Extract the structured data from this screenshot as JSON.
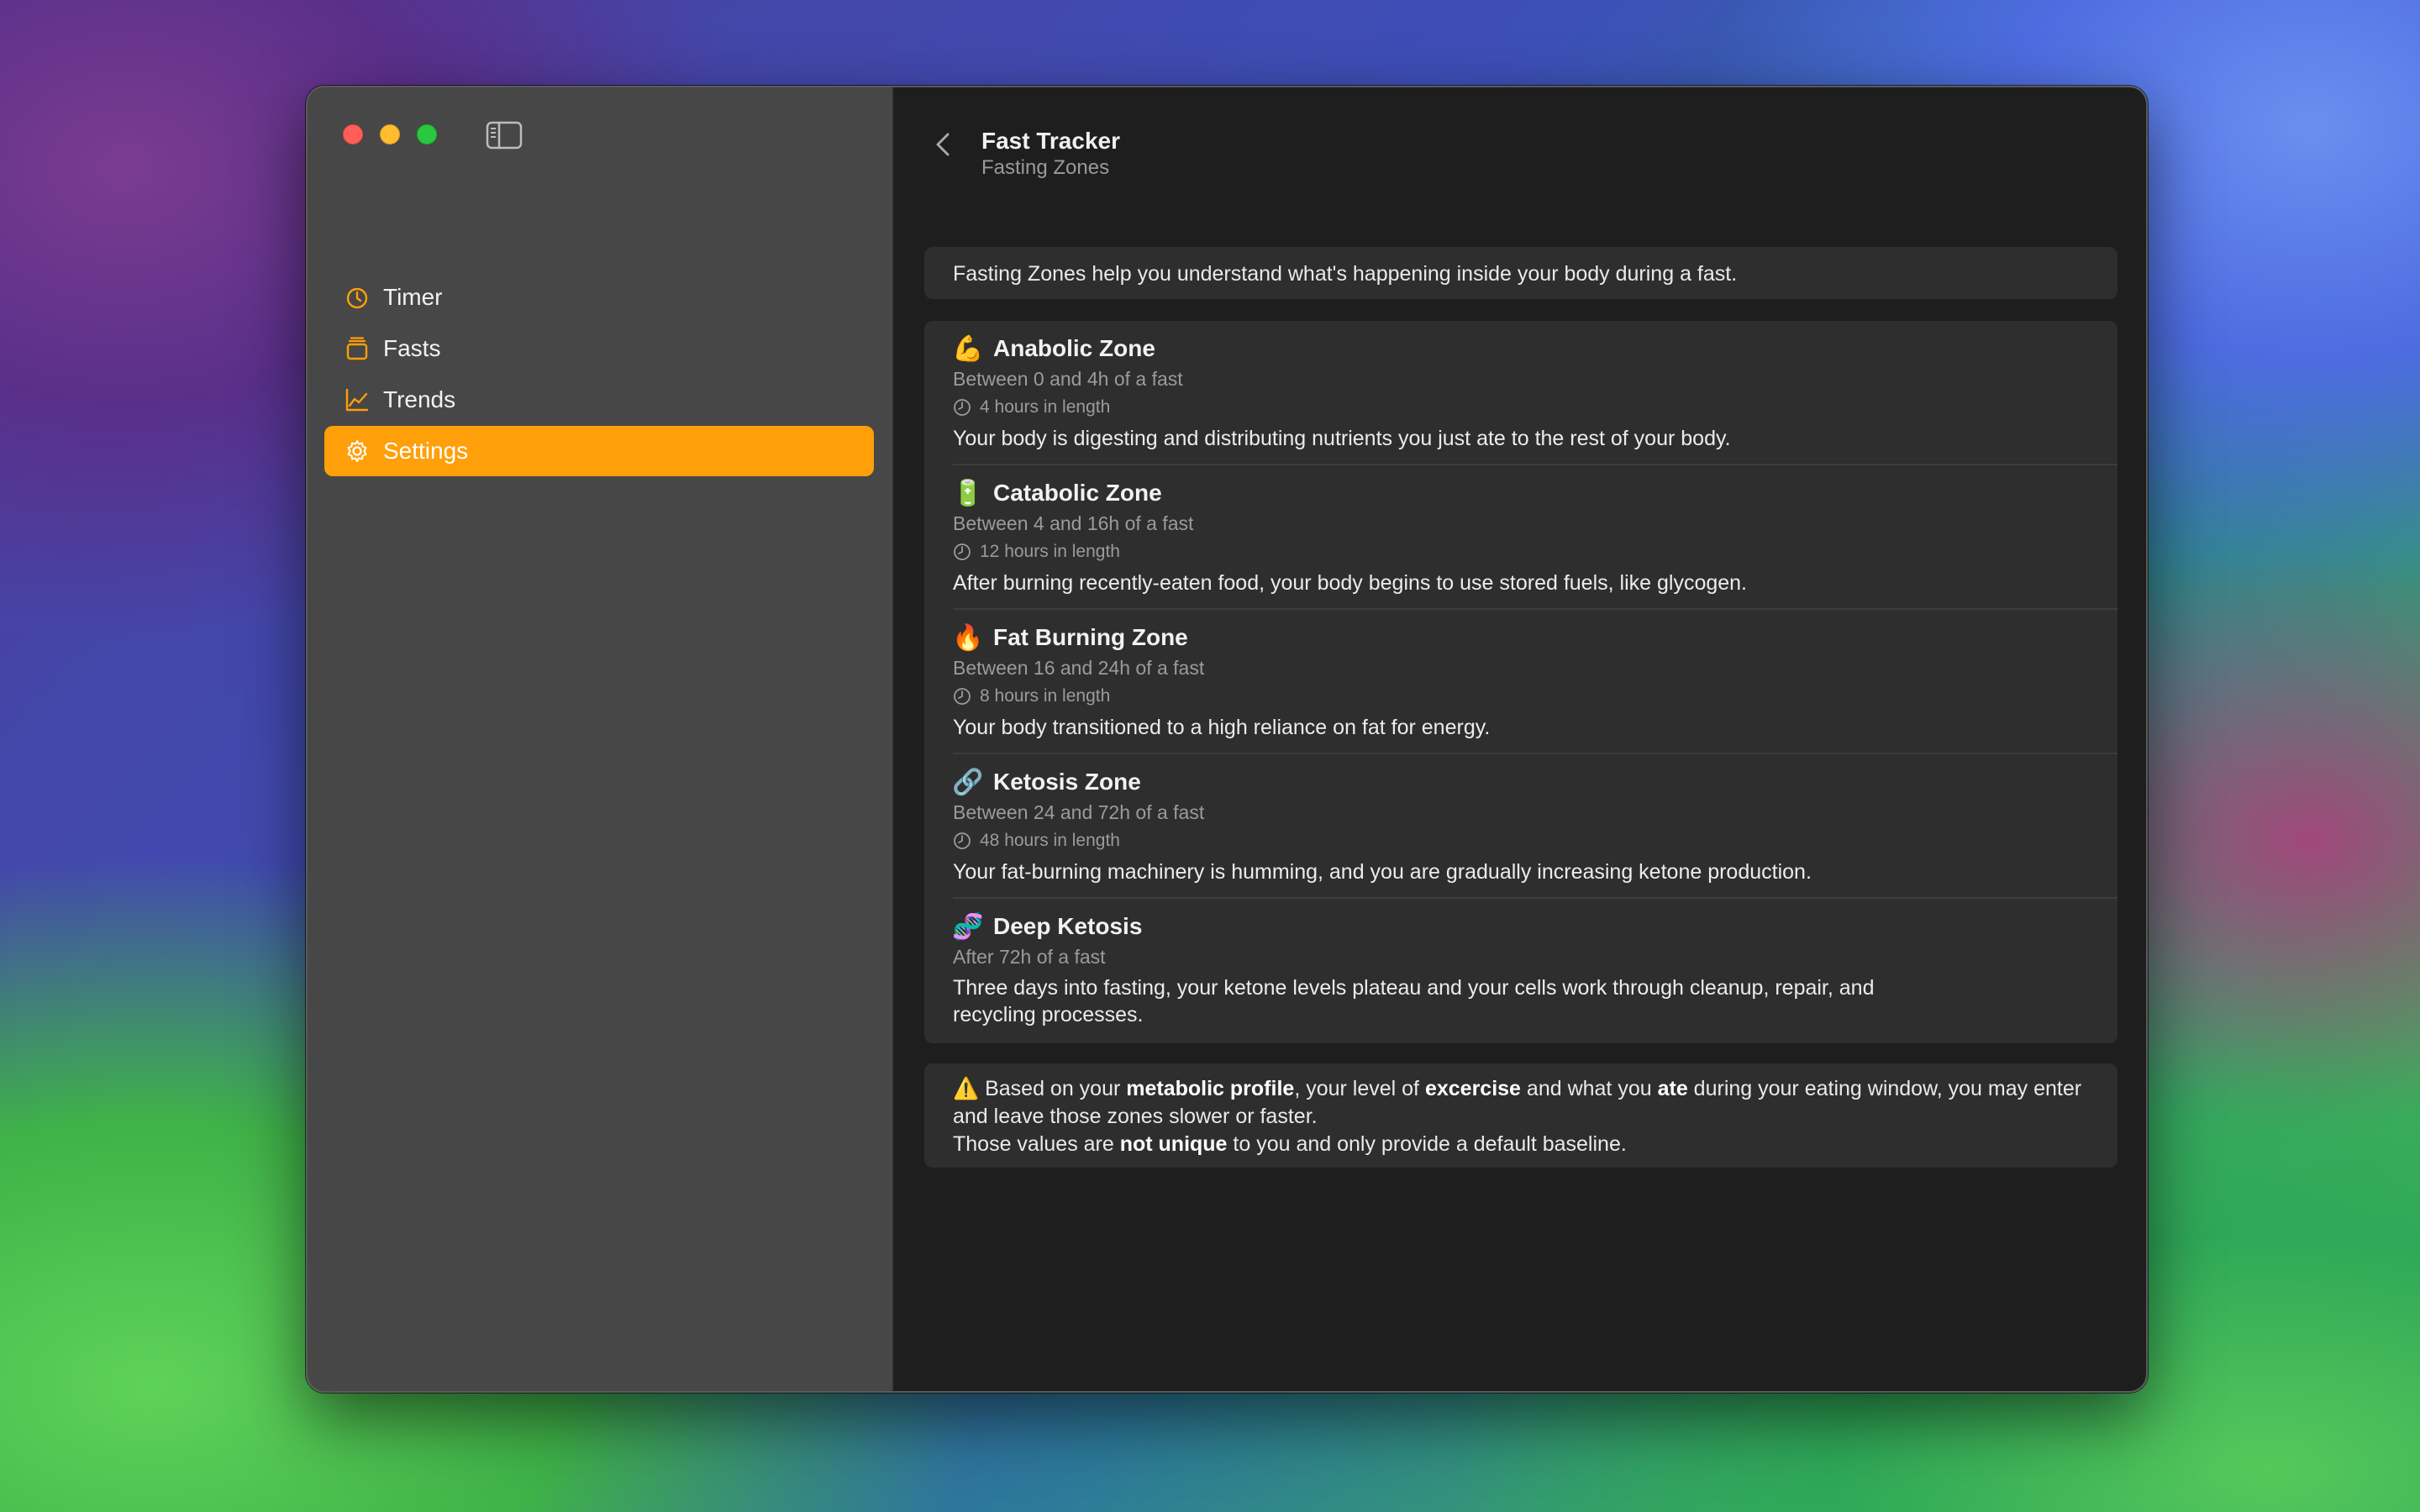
{
  "window": {
    "title": "Fast Tracker",
    "subtitle": "Fasting Zones"
  },
  "sidebar": {
    "items": [
      {
        "label": "Timer",
        "icon": "timer-icon"
      },
      {
        "label": "Fasts",
        "icon": "stack-icon"
      },
      {
        "label": "Trends",
        "icon": "chart-icon"
      },
      {
        "label": "Settings",
        "icon": "gear-icon",
        "selected": true
      }
    ]
  },
  "intro": "Fasting Zones help you understand what's happening inside your body during a fast.",
  "zones": [
    {
      "emoji": "💪",
      "name": "Anabolic Zone",
      "range": "Between 0 and 4h of a fast",
      "length": "4 hours in length",
      "description": "Your body is digesting and distributing nutrients you just ate to the rest of your body."
    },
    {
      "emoji": "🔋",
      "name": "Catabolic Zone",
      "range": "Between 4 and 16h of a fast",
      "length": "12 hours in length",
      "description": "After burning recently-eaten food, your body begins to use stored fuels, like glycogen."
    },
    {
      "emoji": "🔥",
      "name": "Fat Burning Zone",
      "range": "Between 16 and 24h of a fast",
      "length": "8 hours in length",
      "description": "Your body transitioned to a high reliance on fat for energy."
    },
    {
      "emoji": "🔗",
      "name": "Ketosis Zone",
      "range": "Between 24 and 72h of a fast",
      "length": "48 hours in length",
      "description": "Your fat-burning machinery is humming, and you are gradually increasing ketone production."
    },
    {
      "emoji": "🧬",
      "name": "Deep Ketosis",
      "range": "After 72h of a fast",
      "description": "Three days into fasting, your ketone levels plateau and your cells work through cleanup, repair, and recycling processes."
    }
  ],
  "note": {
    "icon": "⚠️",
    "p1": "Based on your ",
    "b1": "metabolic profile",
    "p2": ", your level of ",
    "b2": "excercise",
    "p3": " and what you ",
    "b3": "ate",
    "p4": " during your eating window, you may enter and leave those zones slower or faster.",
    "p5": "Those values are ",
    "b4": "not unique",
    "p6": " to you and only provide a default baseline."
  },
  "colors": {
    "accent": "#ff9f0a",
    "sidebar_bg": "#474747",
    "main_bg": "#1e1e1e",
    "card_bg": "#2e2e2e"
  }
}
